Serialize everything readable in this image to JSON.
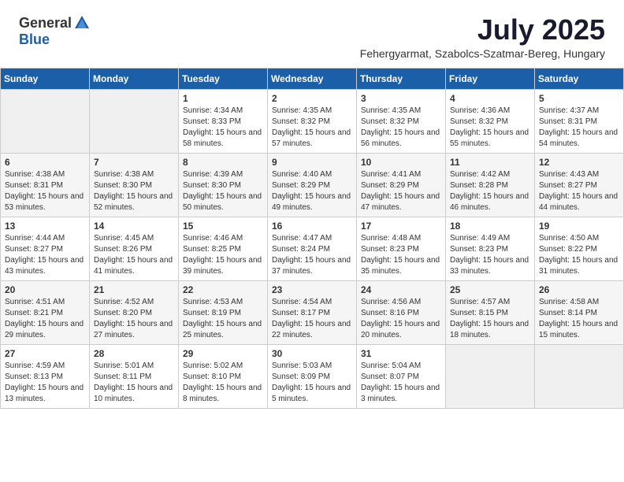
{
  "header": {
    "logo_general": "General",
    "logo_blue": "Blue",
    "month": "July 2025",
    "location": "Fehergyarmat, Szabolcs-Szatmar-Bereg, Hungary"
  },
  "days_of_week": [
    "Sunday",
    "Monday",
    "Tuesday",
    "Wednesday",
    "Thursday",
    "Friday",
    "Saturday"
  ],
  "weeks": [
    [
      {
        "day": "",
        "content": ""
      },
      {
        "day": "",
        "content": ""
      },
      {
        "day": "1",
        "content": "Sunrise: 4:34 AM\nSunset: 8:33 PM\nDaylight: 15 hours and 58 minutes."
      },
      {
        "day": "2",
        "content": "Sunrise: 4:35 AM\nSunset: 8:32 PM\nDaylight: 15 hours and 57 minutes."
      },
      {
        "day": "3",
        "content": "Sunrise: 4:35 AM\nSunset: 8:32 PM\nDaylight: 15 hours and 56 minutes."
      },
      {
        "day": "4",
        "content": "Sunrise: 4:36 AM\nSunset: 8:32 PM\nDaylight: 15 hours and 55 minutes."
      },
      {
        "day": "5",
        "content": "Sunrise: 4:37 AM\nSunset: 8:31 PM\nDaylight: 15 hours and 54 minutes."
      }
    ],
    [
      {
        "day": "6",
        "content": "Sunrise: 4:38 AM\nSunset: 8:31 PM\nDaylight: 15 hours and 53 minutes."
      },
      {
        "day": "7",
        "content": "Sunrise: 4:38 AM\nSunset: 8:30 PM\nDaylight: 15 hours and 52 minutes."
      },
      {
        "day": "8",
        "content": "Sunrise: 4:39 AM\nSunset: 8:30 PM\nDaylight: 15 hours and 50 minutes."
      },
      {
        "day": "9",
        "content": "Sunrise: 4:40 AM\nSunset: 8:29 PM\nDaylight: 15 hours and 49 minutes."
      },
      {
        "day": "10",
        "content": "Sunrise: 4:41 AM\nSunset: 8:29 PM\nDaylight: 15 hours and 47 minutes."
      },
      {
        "day": "11",
        "content": "Sunrise: 4:42 AM\nSunset: 8:28 PM\nDaylight: 15 hours and 46 minutes."
      },
      {
        "day": "12",
        "content": "Sunrise: 4:43 AM\nSunset: 8:27 PM\nDaylight: 15 hours and 44 minutes."
      }
    ],
    [
      {
        "day": "13",
        "content": "Sunrise: 4:44 AM\nSunset: 8:27 PM\nDaylight: 15 hours and 43 minutes."
      },
      {
        "day": "14",
        "content": "Sunrise: 4:45 AM\nSunset: 8:26 PM\nDaylight: 15 hours and 41 minutes."
      },
      {
        "day": "15",
        "content": "Sunrise: 4:46 AM\nSunset: 8:25 PM\nDaylight: 15 hours and 39 minutes."
      },
      {
        "day": "16",
        "content": "Sunrise: 4:47 AM\nSunset: 8:24 PM\nDaylight: 15 hours and 37 minutes."
      },
      {
        "day": "17",
        "content": "Sunrise: 4:48 AM\nSunset: 8:23 PM\nDaylight: 15 hours and 35 minutes."
      },
      {
        "day": "18",
        "content": "Sunrise: 4:49 AM\nSunset: 8:23 PM\nDaylight: 15 hours and 33 minutes."
      },
      {
        "day": "19",
        "content": "Sunrise: 4:50 AM\nSunset: 8:22 PM\nDaylight: 15 hours and 31 minutes."
      }
    ],
    [
      {
        "day": "20",
        "content": "Sunrise: 4:51 AM\nSunset: 8:21 PM\nDaylight: 15 hours and 29 minutes."
      },
      {
        "day": "21",
        "content": "Sunrise: 4:52 AM\nSunset: 8:20 PM\nDaylight: 15 hours and 27 minutes."
      },
      {
        "day": "22",
        "content": "Sunrise: 4:53 AM\nSunset: 8:19 PM\nDaylight: 15 hours and 25 minutes."
      },
      {
        "day": "23",
        "content": "Sunrise: 4:54 AM\nSunset: 8:17 PM\nDaylight: 15 hours and 22 minutes."
      },
      {
        "day": "24",
        "content": "Sunrise: 4:56 AM\nSunset: 8:16 PM\nDaylight: 15 hours and 20 minutes."
      },
      {
        "day": "25",
        "content": "Sunrise: 4:57 AM\nSunset: 8:15 PM\nDaylight: 15 hours and 18 minutes."
      },
      {
        "day": "26",
        "content": "Sunrise: 4:58 AM\nSunset: 8:14 PM\nDaylight: 15 hours and 15 minutes."
      }
    ],
    [
      {
        "day": "27",
        "content": "Sunrise: 4:59 AM\nSunset: 8:13 PM\nDaylight: 15 hours and 13 minutes."
      },
      {
        "day": "28",
        "content": "Sunrise: 5:01 AM\nSunset: 8:11 PM\nDaylight: 15 hours and 10 minutes."
      },
      {
        "day": "29",
        "content": "Sunrise: 5:02 AM\nSunset: 8:10 PM\nDaylight: 15 hours and 8 minutes."
      },
      {
        "day": "30",
        "content": "Sunrise: 5:03 AM\nSunset: 8:09 PM\nDaylight: 15 hours and 5 minutes."
      },
      {
        "day": "31",
        "content": "Sunrise: 5:04 AM\nSunset: 8:07 PM\nDaylight: 15 hours and 3 minutes."
      },
      {
        "day": "",
        "content": ""
      },
      {
        "day": "",
        "content": ""
      }
    ]
  ]
}
